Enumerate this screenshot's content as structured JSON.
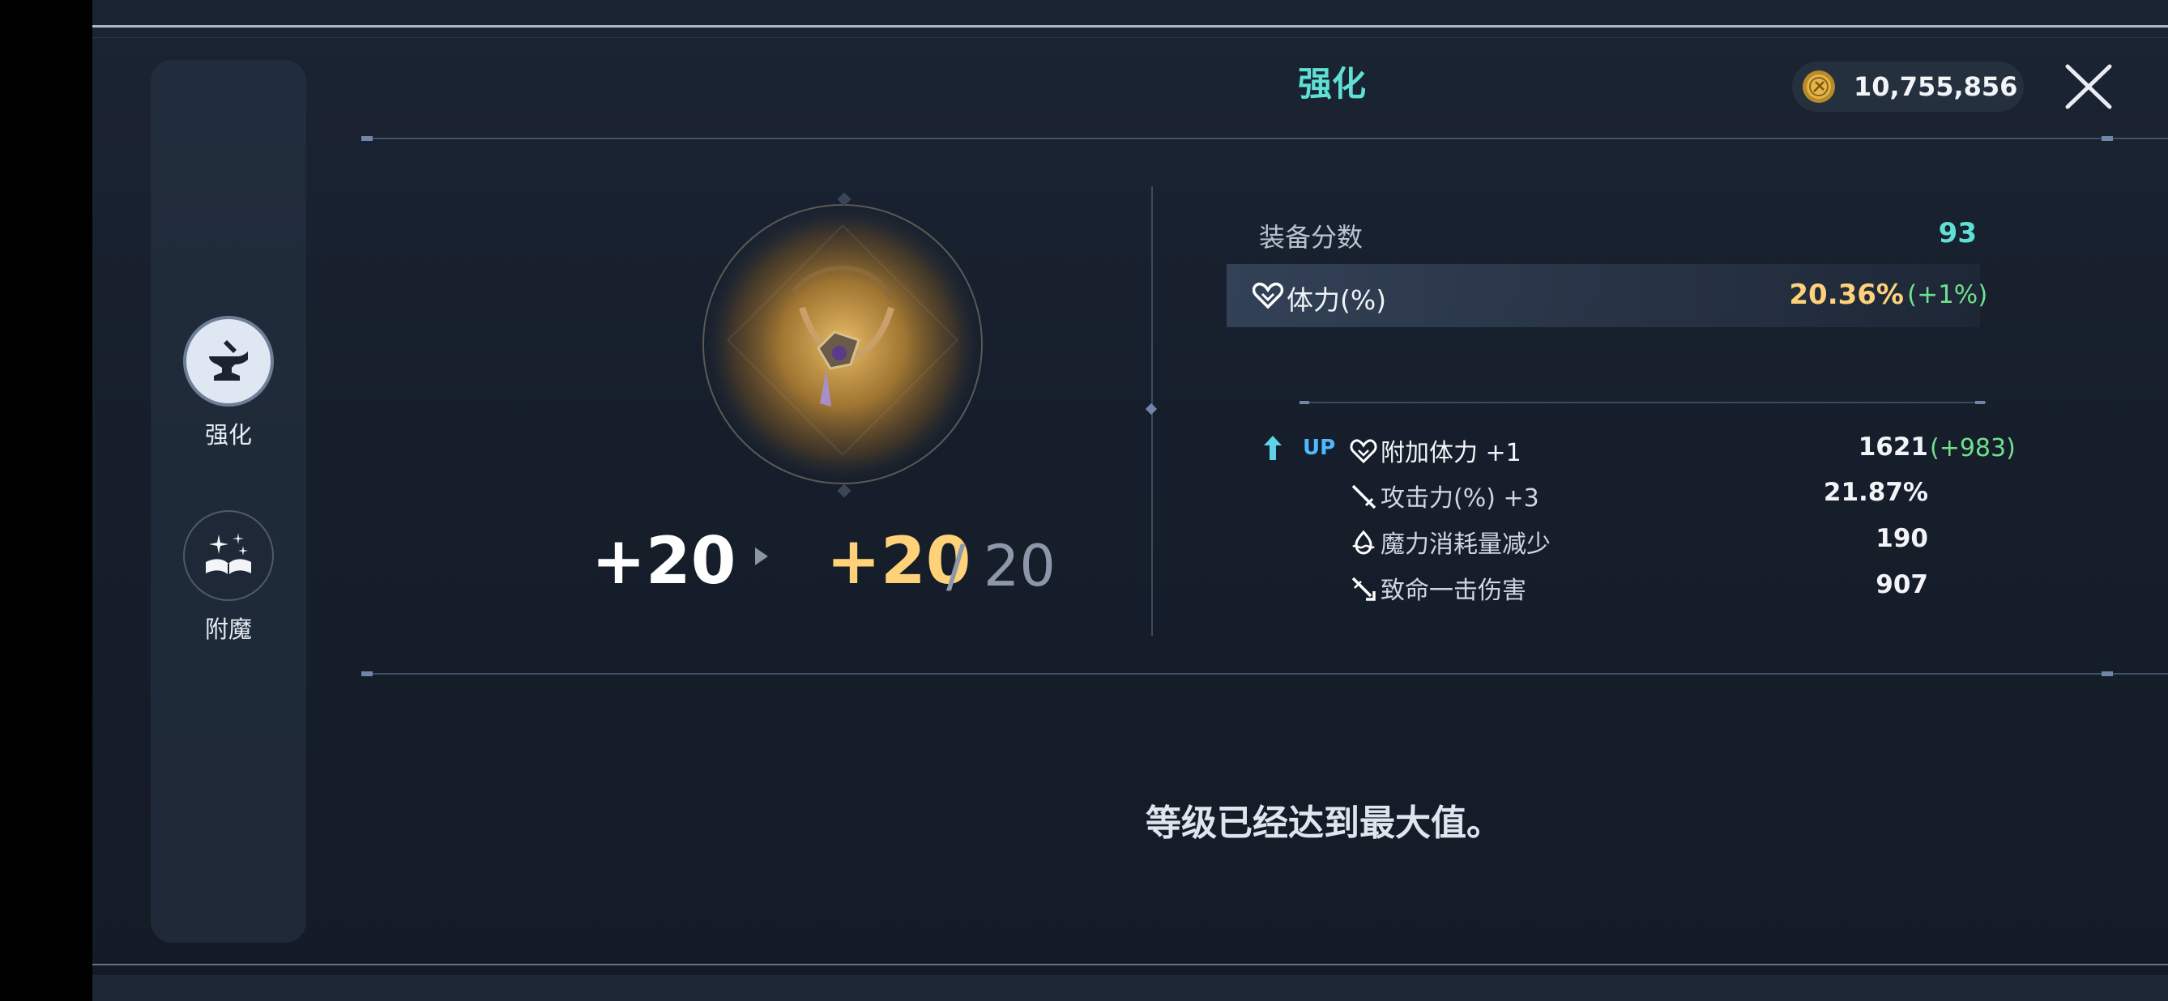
{
  "screen": {
    "title": "强化",
    "currency": {
      "icon": "gold-coin-icon",
      "amount": "10,755,856"
    }
  },
  "sidebar": {
    "items": [
      {
        "label": "强化",
        "icon": "anvil-icon",
        "active": true
      },
      {
        "label": "附魔",
        "icon": "enchant-book-icon",
        "active": false
      }
    ]
  },
  "item": {
    "icon": "necklace-icon",
    "current_level": "+20",
    "next_level": "+20",
    "max_level": "/ 20"
  },
  "stats": {
    "score_label": "装备分数",
    "score_value": "93",
    "main_stat": {
      "icon": "heart-icon",
      "label": "体力(%)",
      "value": "20.36%",
      "delta": "(+1%)"
    },
    "up_tag": "UP",
    "sub_stats": [
      {
        "icon": "heart-icon",
        "label": "附加体力 +1",
        "value": "1621",
        "delta": "(+983)"
      },
      {
        "icon": "sword-icon",
        "label": "攻击力(%) +3",
        "value": "21.87%",
        "delta": ""
      },
      {
        "icon": "mana-icon",
        "label": "魔力消耗量减少",
        "value": "190",
        "delta": ""
      },
      {
        "icon": "critical-icon",
        "label": "致命一击伤害",
        "value": "907",
        "delta": ""
      }
    ]
  },
  "message": "等级已经达到最大值。",
  "colors": {
    "accent": "#5fe0d4",
    "gold": "#ffd27a",
    "positive": "#6fe08e",
    "up": "#4fb8ff"
  }
}
